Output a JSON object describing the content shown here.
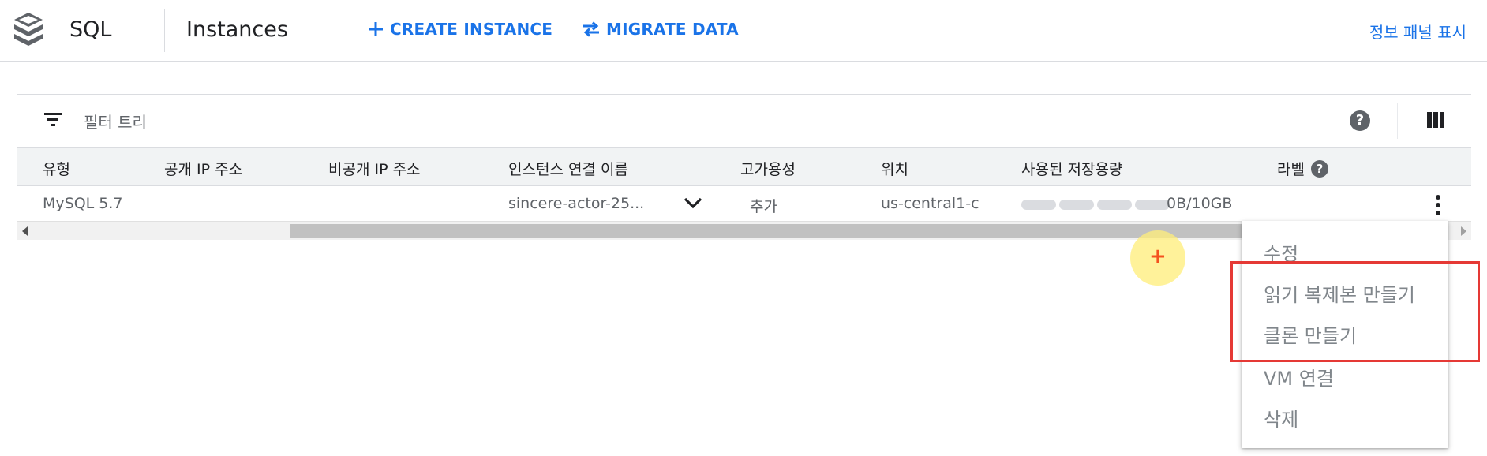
{
  "header": {
    "product": "SQL",
    "page_title": "Instances",
    "actions": {
      "create": "CREATE INSTANCE",
      "migrate": "MIGRATE DATA"
    },
    "info_panel": "정보 패널 표시"
  },
  "icons": {
    "logo": "sql-stack-icon",
    "create": "plus-icon",
    "migrate": "swap-arrows-icon",
    "filter": "filter-icon",
    "help": "help-icon",
    "columns": "column-display-icon",
    "expand": "chevron-down-icon",
    "more": "more-vert-icon"
  },
  "filter": {
    "placeholder": "필터 트리"
  },
  "help_glyph": "?",
  "table": {
    "columns": {
      "type": "유형",
      "public_ip": "공개 IP 주소",
      "private_ip": "비공개 IP 주소",
      "connection_name": "인스턴스 연결 이름",
      "ha": "고가용성",
      "location": "위치",
      "storage": "사용된 저장용량",
      "labels": "라벨"
    },
    "rows": [
      {
        "type": "MySQL 5.7",
        "public_ip": "",
        "private_ip": "",
        "connection_name": "sincere-actor-25...",
        "ha": "추가",
        "location": "us-central1-c",
        "storage_text": "0B/10GB",
        "storage_used_fraction": 0
      }
    ]
  },
  "context_menu": {
    "items": [
      "수정",
      "읽기 복제본 만들기",
      "클론 만들기",
      "VM 연결",
      "삭제"
    ]
  },
  "colors": {
    "accent": "#1a73e8",
    "highlight": "#e53935",
    "menu_text": "#80868b"
  }
}
